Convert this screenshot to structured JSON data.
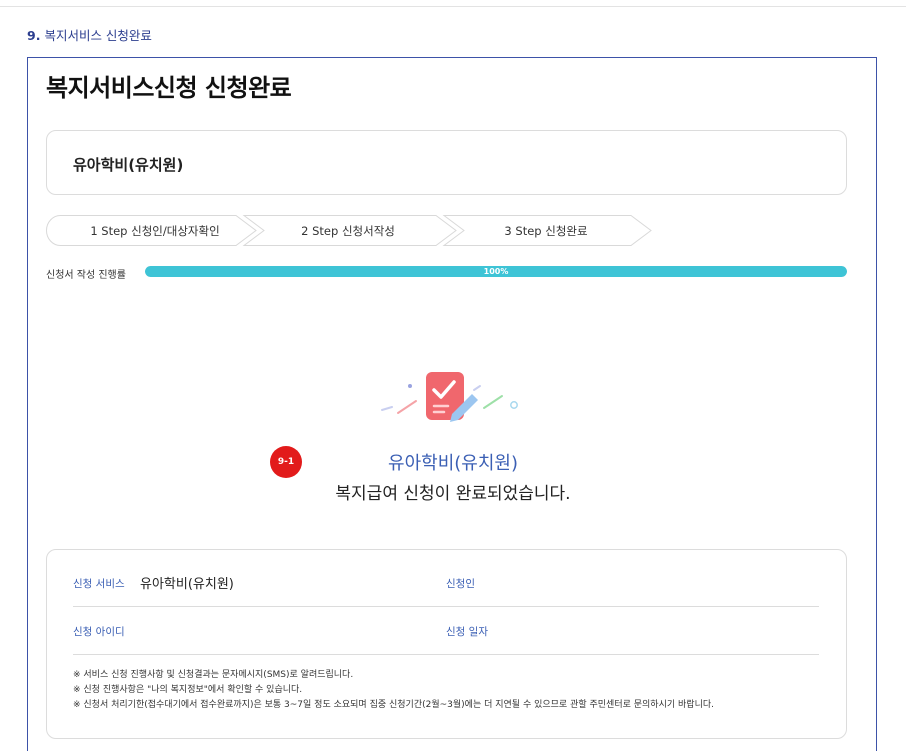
{
  "section": {
    "number": "9.",
    "title": "복지서비스 신청완료"
  },
  "page": {
    "title": "복지서비스신청 신청완료"
  },
  "service_name": "유아학비(유치원)",
  "steps": [
    {
      "label": "1 Step 신청인/대상자확인"
    },
    {
      "label": "2 Step 신청서작성"
    },
    {
      "label": "3 Step 신청완료"
    }
  ],
  "progress": {
    "label": "신청서 작성 진행률",
    "percent_text": "100%",
    "value": 100,
    "color": "#3ec4d6"
  },
  "completion": {
    "marker": "9-1",
    "service": "유아학비(유치원)",
    "message": "복지급여 신청이 완료되었습니다."
  },
  "summary": {
    "service_label": "신청 서비스",
    "service_value": "유아학비(유치원)",
    "applicant_label": "신청인",
    "id_label": "신청 아이디",
    "date_label": "신청 일자"
  },
  "notes": [
    "※ 서비스 신청 진행사항 및 신청결과는 문자메시지(SMS)로 알려드립니다.",
    "※ 신청 진행사항은 \"나의 복지정보\"에서 확인할 수 있습니다.",
    "※ 신청서 처리기한(접수대기에서 접수완료까지)은 보통 3~7일 정도 소요되며 집중 신청기간(2월~3월)에는 더 지연될 수 있으므로 관할 주민센터로 문의하시기 바랍니다."
  ],
  "colors": {
    "accent": "#3b5fb4",
    "frame": "#3d52a8",
    "marker": "#e21b1b",
    "icon": "#f0676d"
  }
}
